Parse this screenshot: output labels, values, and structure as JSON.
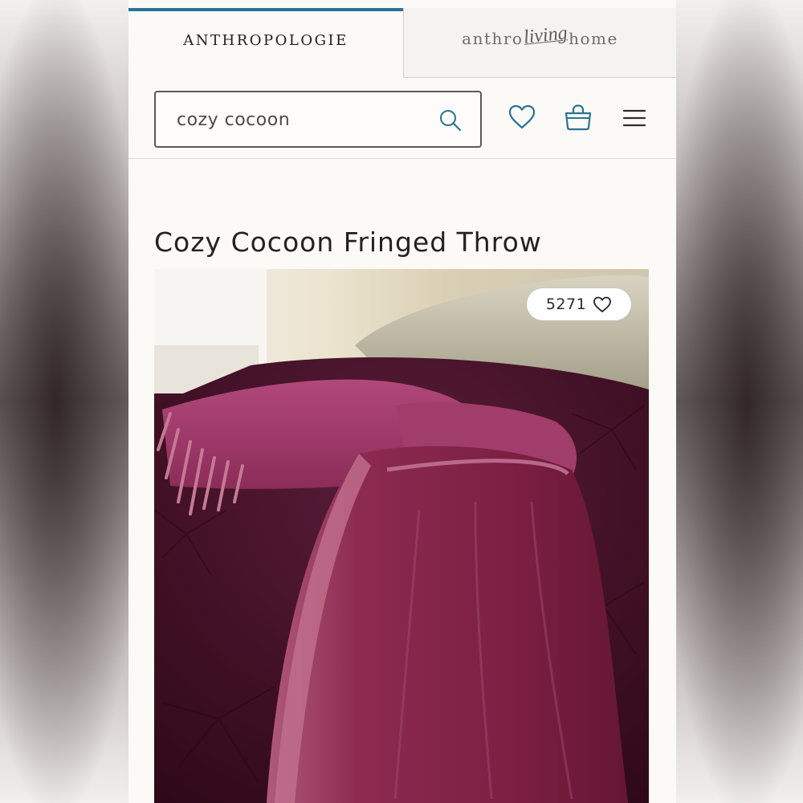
{
  "brand_tabs": {
    "primary": "ANTHROPOLOGIE",
    "secondary": {
      "prefix": "anthro",
      "script": "living",
      "suffix": "home"
    }
  },
  "search": {
    "value": "cozy cocoon"
  },
  "icons": {
    "search": "search-icon",
    "wishlist": "heart-icon",
    "bag": "shopping-bag-icon",
    "menu": "hamburger-menu-icon"
  },
  "product": {
    "title": "Cozy Cocoon Fringed Throw",
    "like_count": "5271"
  },
  "colors": {
    "accent": "#2a7396",
    "icon_teal": "#2a7396",
    "throw_color": "#8e2a55",
    "background": "#fbfaf6"
  }
}
